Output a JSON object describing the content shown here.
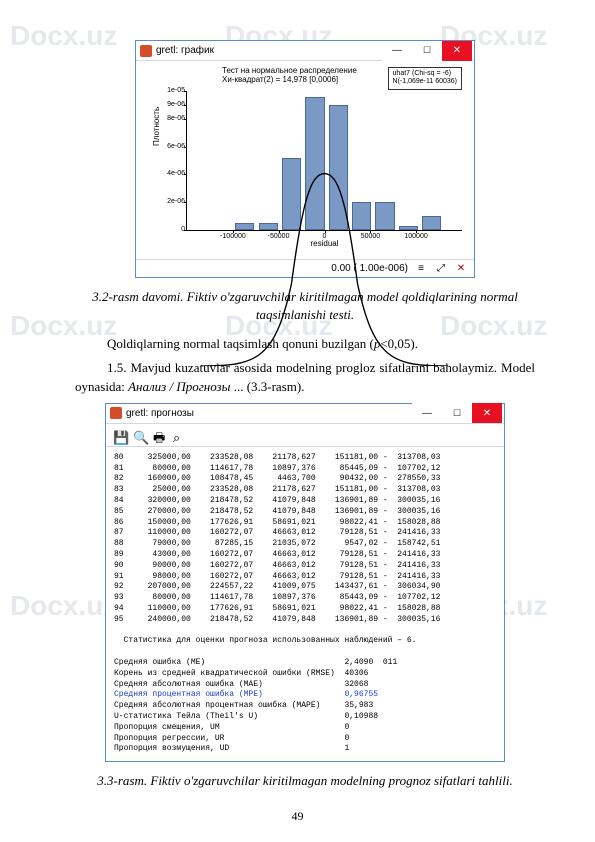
{
  "watermarks": [
    "Docx.uz",
    "Docx.uz",
    "Docx.uz",
    "Docx.uz",
    "Docx.uz",
    "Docx.uz",
    "Docx.uz",
    "Docx.uz",
    "Docx.uz"
  ],
  "chart_window": {
    "title": "gretl: график",
    "minimize": "Minimize",
    "maximize": "Maximize",
    "close": "Close"
  },
  "chart_data": {
    "type": "bar",
    "title_line1": "Тест на нормальное распределение",
    "title_line2": "Хи-квадрат(2) = 14,978 [0,0006]",
    "legend_line1": "uhat7 (Chi-sq = -6)",
    "legend_line2": "N(-1,069e-11 60036)",
    "xlabel": "residual",
    "ylabel": "Плотность",
    "xlim": [
      -150000,
      150000
    ],
    "ylim": [
      0,
      1e-05
    ],
    "xticks": [
      "-100000",
      "-50000",
      "0",
      "50000",
      "100000"
    ],
    "yticks": [
      "0",
      "2e-06",
      "4e-06",
      "6e-06",
      "8e-06",
      "9e-06",
      "1e-05"
    ],
    "bars": [
      {
        "x_center": -87500,
        "height": 5e-07
      },
      {
        "x_center": -62500,
        "height": 5e-07
      },
      {
        "x_center": -37500,
        "height": 5.2e-06
      },
      {
        "x_center": -12500,
        "height": 9.6e-06
      },
      {
        "x_center": 12500,
        "height": 9e-06
      },
      {
        "x_center": 37500,
        "height": 2e-06
      },
      {
        "x_center": 62500,
        "height": 2e-06
      },
      {
        "x_center": 87500,
        "height": 3e-07
      },
      {
        "x_center": 112500,
        "height": 1e-06
      }
    ],
    "normal_curve": true
  },
  "footer_text": "0.00 ( 1.00e-006)",
  "caption1_line1": "3.2-rasm davomi. Fiktiv o'zgaruvchilar kiritilmagan model qoldiqlarining normal",
  "caption1_line2": "taqsimlanishi testi.",
  "para1": "Qoldiqlarning normal taqsimlash qonuni buzilgan (",
  "para1_math": "p",
  "para1_tail": "<0,05).",
  "para2": "1.5.  Mavjud  kuzatuvlar  asosida  modelning  progloz  sifatlarini  baholaymiz. Model oynasida: ",
  "para2_ital": "Анализ / Прогнозы",
  "para2_tail": " ... (3.3-rasm).",
  "forecast_window": {
    "title": "gretl: прогнозы",
    "tool_save": "Save",
    "tool_plus": "Zoom",
    "tool_print": "Print",
    "tool_search": "Search"
  },
  "forecast_rows": [
    "80     325000,00    233528,08    21178,627    151181,00 -  313708,03",
    "81      80000,00    114617,78    10897,376     85445,09 -  107702,12",
    "82     160000,00    108478,45     4463,700     90432,00 -  278550,33",
    "83      25000,00    233528,08    21178,627    151181,00 -  313708,03",
    "84     320000,00    218478,52    41079,848    136901,89 -  300035,16",
    "85     270000,00    218478,52    41079,848    136901,89 -  300035,16",
    "86     150000,00    177626,91    58691,021     98022,41 -  158028,88",
    "87     110000,00    160272,07    46663,012     79128,51 -  241416,33",
    "88      79000,00     87285,15    21035,072      9547,02 -  158742,51",
    "89      43000,00    160272,07    46663,012     79128,51 -  241416,33",
    "90      90000,00    160272,07    46663,012     79128,51 -  241416,33",
    "91      98000,00    160272,07    46663,012     79128,51 -  241416,33",
    "92     207000,00    224557,22    41009,075    143437,61 -  306034,90",
    "93      80000,00    114617,78    10897,376     85443,09 -  107702,12",
    "94     110000,00    177626,91    58691,021     98022,41 -  158028,88",
    "95     240000,00    218478,52    41079,848    136901,89 -  300035,16"
  ],
  "forecast_stats_header": "Статистика для оценки прогноза использованных наблюдений – 6.",
  "forecast_stats": [
    {
      "label": "Средняя ошибка (МЕ)",
      "value": "2,4090  011"
    },
    {
      "label": "Корень из средней квадратической ошибки (RMSE)",
      "value": "40306"
    },
    {
      "label": "Средняя абсолютная ошибка (МАЕ)",
      "value": "32068"
    },
    {
      "label": "Средняя процентная ошибка (MPE)",
      "value": "0,96755",
      "blue": true
    },
    {
      "label": "Средняя абсолютная процентная ошибка (MAPE)",
      "value": "35,983"
    },
    {
      "label": "U-статистика Тейла (Theil's U)",
      "value": "0,10988"
    },
    {
      "label": "Пропорция смещения, UM",
      "value": "0"
    },
    {
      "label": "Пропорция регрессии, UR",
      "value": "0"
    },
    {
      "label": "Пропорция возмущения, UD",
      "value": "1"
    }
  ],
  "caption2": "3.3-rasm. Fiktiv o'zgaruvchilar kiritilmagan modelning prognoz sifatlari tahlili.",
  "page_number": "49"
}
